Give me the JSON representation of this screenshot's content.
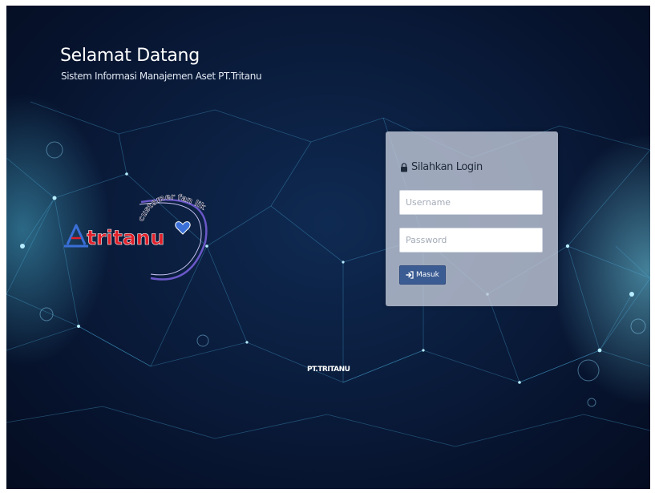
{
  "header": {
    "title": "Selamat Datang",
    "subtitle": "Sistem Informasi Manajemen Aset PT.Tritanu"
  },
  "logo": {
    "brand": "tritanu",
    "tagline": "customer fan like"
  },
  "login": {
    "heading": "Silahkan Login",
    "username_placeholder": "Username",
    "password_placeholder": "Password",
    "submit_label": "Masuk",
    "lock_icon": "lock-icon",
    "submit_icon": "sign-in-icon"
  },
  "footer": {
    "text": "PT.TRITANU"
  },
  "colors": {
    "background": "#0a1c3c",
    "panel": "#bec6d6",
    "button": "#3b5c93",
    "brand_red": "#e0202a",
    "brand_blue": "#3a6fd8"
  }
}
